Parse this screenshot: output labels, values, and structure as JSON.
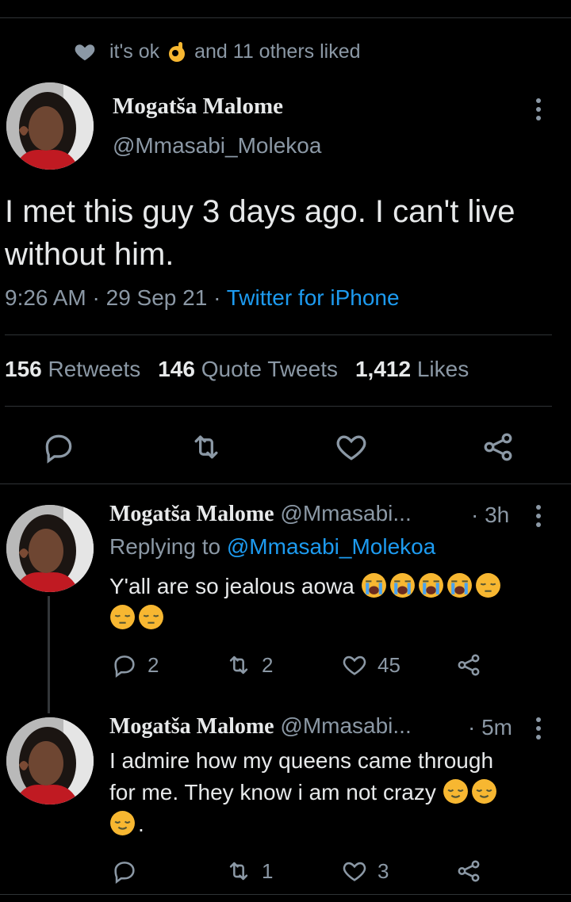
{
  "social_context": {
    "liked_by": "it's ok",
    "liked_by_emoji": "ok-hand-emoji",
    "others": "and 11 others liked"
  },
  "tweet": {
    "author_name": "Mogatša Malome",
    "author_handle": "@Mmasabi_Molekoa",
    "text": "I met this guy 3 days ago. I can't live without him.",
    "time": "9:26 AM",
    "date": "29 Sep 21",
    "sep": "·",
    "source": "Twitter for iPhone",
    "stats": {
      "retweets_count": "156",
      "retweets_label": "Retweets",
      "quotes_count": "146",
      "quotes_label": "Quote Tweets",
      "likes_count": "1,412",
      "likes_label": "Likes"
    },
    "actions": [
      "reply-icon",
      "retweet-icon",
      "like-icon",
      "share-icon"
    ]
  },
  "replies": [
    {
      "author_name": "Mogatša Malome",
      "author_handle": "@Mmasabi...",
      "time": "· 3h",
      "replying_prefix": "Replying to",
      "replying_handle": "@Mmasabi_Molekoa",
      "text": "Y'all are so jealous aowa",
      "emojis": [
        "loudly-crying-face",
        "loudly-crying-face",
        "loudly-crying-face",
        "loudly-crying-face",
        "pensive-face",
        "pensive-face",
        "pensive-face"
      ],
      "reply_count": "2",
      "retweet_count": "2",
      "like_count": "45"
    },
    {
      "author_name": "Mogatša Malome",
      "author_handle": "@Mmasabi...",
      "time": "· 5m",
      "text_line1": "I admire how my queens came through",
      "text_line2": "for me. They know i am not crazy",
      "text_end": ".",
      "emojis": [
        "relieved-face",
        "relieved-face",
        "relieved-face"
      ],
      "reply_count": "",
      "retweet_count": "1",
      "like_count": "3"
    }
  ],
  "colors": {
    "background": "#000000",
    "text": "#e7e9ea",
    "secondary": "#8b98a5",
    "accent": "#1d9bf0",
    "divider": "#2f3336"
  }
}
